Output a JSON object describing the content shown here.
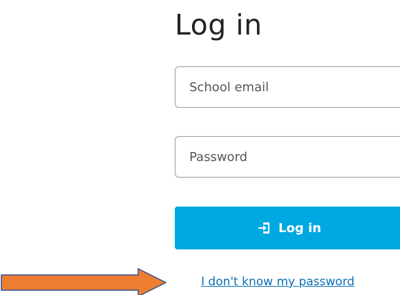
{
  "header": {
    "title": "Log in"
  },
  "form": {
    "email_placeholder": "School email",
    "password_placeholder": "Password",
    "submit_label": "Log in",
    "submit_icon": "login-door-icon",
    "forgot_link": "I don't know my password"
  },
  "colors": {
    "primary_button": "#00a8e1",
    "link": "#0b6fb6",
    "annotation_arrow_fill": "#ed7d31",
    "annotation_arrow_stroke": "#2f4f8f"
  }
}
